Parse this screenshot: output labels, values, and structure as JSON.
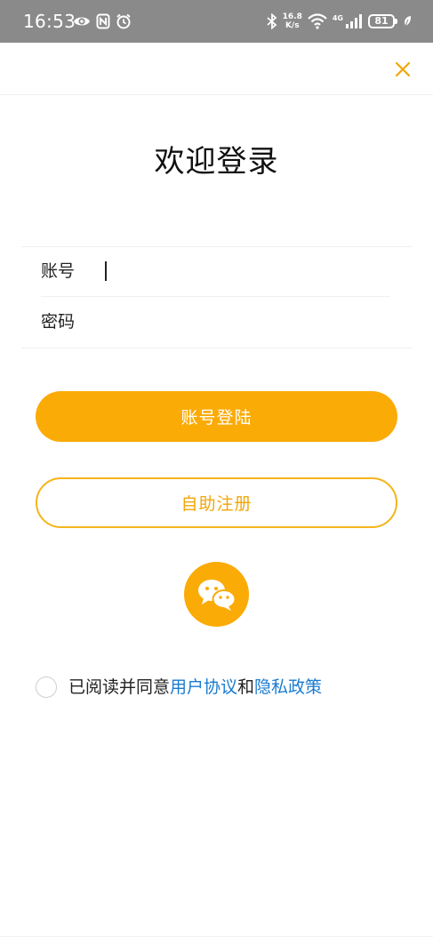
{
  "status_bar": {
    "time": "16:53",
    "net_speed_value": "16.8",
    "net_speed_unit": "K/s",
    "network_type": "4G",
    "battery": "81",
    "icons": [
      "eye-icon",
      "nfc-icon",
      "alarm-icon",
      "bluetooth-icon",
      "wifi-icon",
      "signal-icon",
      "battery-icon",
      "leaf-icon"
    ]
  },
  "header": {
    "close_icon": "close-icon"
  },
  "login": {
    "title": "欢迎登录",
    "account_label": "账号",
    "account_value": "",
    "password_label": "密码",
    "password_value": "",
    "login_button": "账号登陆",
    "register_button": "自助注册",
    "wechat_icon": "wechat-icon"
  },
  "agreement": {
    "prefix": "已阅读并同意",
    "user_agreement": "用户协议",
    "conjunction": "和",
    "privacy_policy": "隐私政策"
  },
  "colors": {
    "accent": "#fbab05",
    "outline": "#f5b41a",
    "link": "#1a7bd0",
    "status_bar": "#8a8a8a"
  }
}
